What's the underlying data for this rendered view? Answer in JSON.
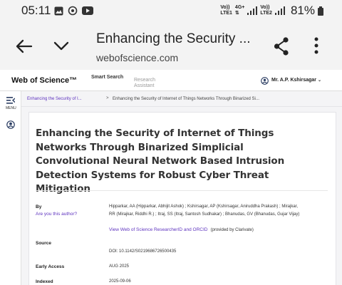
{
  "status_bar": {
    "time": "05:11",
    "net1_top": "Vo))",
    "net1_bottom": "LTE1",
    "net1_type": "4G+",
    "net2_top": "Vo))",
    "net2_bottom": "LTE2",
    "battery": "81%"
  },
  "tab": {
    "title": "Enhancing the Security ...",
    "url": "webofscience.com"
  },
  "wos": {
    "logo": "Web of Science™",
    "nav_smart_search": "Smart Search",
    "nav_research_assistant": "Research Assistant",
    "user": "Mr. A.P. Kshirsagar"
  },
  "rail": {
    "menu_label": "MENU"
  },
  "breadcrumb": {
    "link": "Enhancing the Security of I...",
    "separator": ">",
    "current": "Enhancing the Security of Internet of Things Networks Through Binarized Si..."
  },
  "record": {
    "title": "Enhancing the Security of Internet of Things Networks Through Binarized Simplicial Convolutional Neural Network Based Intrusion Detection Systems for Robust Cyber Threat Mitigation",
    "by_label": "By",
    "are_you_author": "Are you this author?",
    "authors_line1": "Hipparkar, AA (Hipparkar, Abhijit Ashok) ; Kshirsagar, AP (Kshirsagar, Aniruddha Prakash) ; Mirajkar,",
    "authors_line2": "RR (Mirajkar, Riddhi R.) ; Itraj, SS (Itraj, Santosh Sudhakar) ; Bhanudas, GV (Bhanudas, Gujar Vijay)",
    "orcid_link": "View Web of Science ResearcherID and ORCID",
    "orcid_note": "(provided by Clarivate)",
    "source_label": "Source",
    "doi": "DOI: 10.1142/S0219686726500435",
    "early_access_label": "Early Access",
    "early_access_value": "AUG 2025",
    "indexed_label": "Indexed",
    "indexed_value": "2025-09-06"
  },
  "colors": {
    "link": "#5e33bf",
    "header_bg": "#f3f3f3"
  }
}
